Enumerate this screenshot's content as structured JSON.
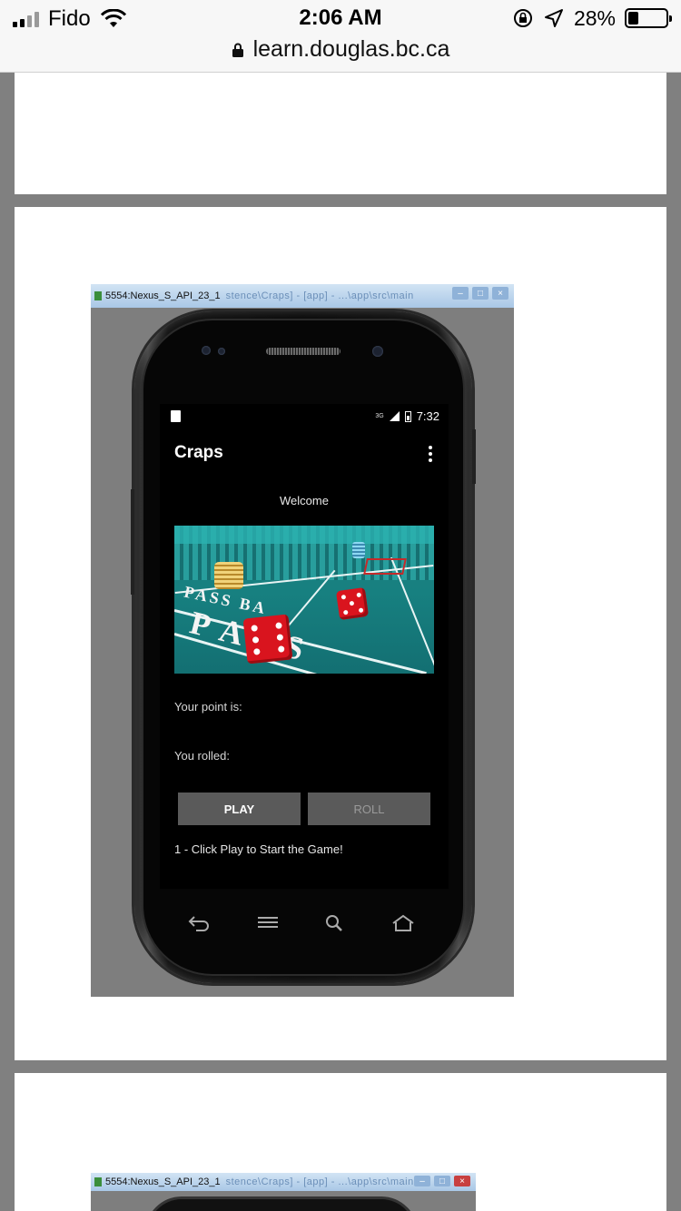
{
  "ios_status": {
    "carrier": "Fido",
    "time": "2:06 AM",
    "battery": "28%",
    "battery_level": 0.28
  },
  "browser": {
    "url": "learn.douglas.bc.ca"
  },
  "emulator": {
    "window_title": "5554:Nexus_S_API_23_1",
    "window_title_obscured": "stence\\Craps] - [app] - ...\\app\\src\\main"
  },
  "android": {
    "status_time": "7:32",
    "network": "3G",
    "app_title": "Craps",
    "welcome": "Welcome",
    "point_label": "Your point is:",
    "rolled_label": "You rolled:",
    "play_button": "PLAY",
    "roll_button": "ROLL",
    "instruction": "1 - Click Play to Start the Game!"
  },
  "table_image": {
    "text_pass_bar": "PASS BA",
    "text_pass": "PASS"
  },
  "emulator2": {
    "window_title": "5554:Nexus_S_API_23_1"
  },
  "colors": {
    "page_bg": "#808080",
    "felt": "#178080",
    "die_red": "#d9141e",
    "button_bg": "#5a5a5a"
  }
}
